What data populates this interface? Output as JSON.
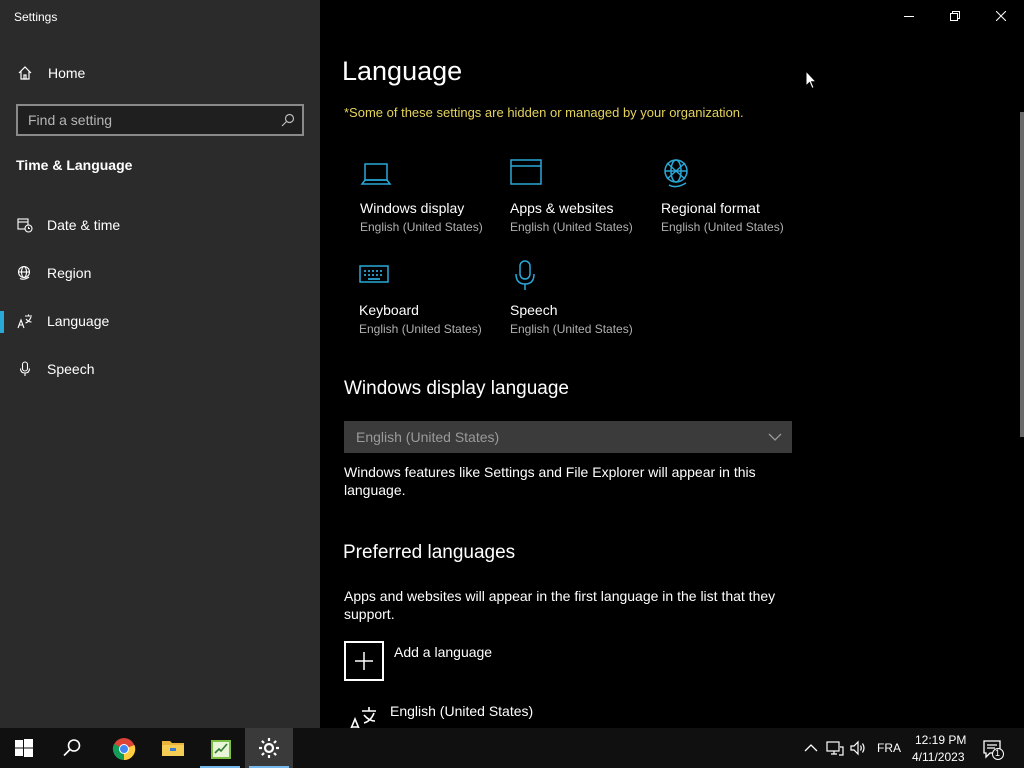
{
  "window": {
    "title": "Settings",
    "controls": [
      "minimize",
      "restore",
      "close"
    ]
  },
  "sidebar": {
    "home_label": "Home",
    "search_placeholder": "Find a setting",
    "section_title": "Time & Language",
    "items": [
      {
        "label": "Date & time",
        "icon": "calendar-clock-icon"
      },
      {
        "label": "Region",
        "icon": "globe-icon"
      },
      {
        "label": "Language",
        "icon": "language-icon",
        "active": true
      },
      {
        "label": "Speech",
        "icon": "microphone-icon"
      }
    ]
  },
  "main": {
    "title": "Language",
    "org_notice": "*Some of these settings are hidden or managed by your organization.",
    "tiles": [
      {
        "title": "Windows display",
        "subtitle": "English (United States)",
        "icon": "laptop-icon"
      },
      {
        "title": "Apps & websites",
        "subtitle": "English (United States)",
        "icon": "window-icon"
      },
      {
        "title": "Regional format",
        "subtitle": "English (United States)",
        "icon": "globe-icon"
      },
      {
        "title": "Keyboard",
        "subtitle": "English (United States)",
        "icon": "keyboard-icon"
      },
      {
        "title": "Speech",
        "subtitle": "English (United States)",
        "icon": "microphone-icon"
      }
    ],
    "display_language": {
      "heading": "Windows display language",
      "selected": "English (United States)",
      "description": "Windows features like Settings and File Explorer will appear in this language."
    },
    "preferred_languages": {
      "heading": "Preferred languages",
      "description": "Apps and websites will appear in the first language in the list that they support.",
      "add_label": "Add a language",
      "languages": [
        {
          "label": "English (United States)",
          "icon": "language-icon"
        }
      ]
    }
  },
  "taskbar": {
    "apps": [
      "start-icon",
      "search-icon",
      "chrome-icon",
      "file-explorer-icon",
      "notepad-icon",
      "settings-icon"
    ],
    "active_app": "settings-icon",
    "input_language": "FRA",
    "time": "12:19 PM",
    "date": "4/11/2023",
    "notification_count": "1"
  },
  "colors": {
    "accent": "#2aa8d8",
    "notice": "#e4d35c",
    "sidebar_bg": "#2b2b2b",
    "main_bg": "#000000"
  }
}
